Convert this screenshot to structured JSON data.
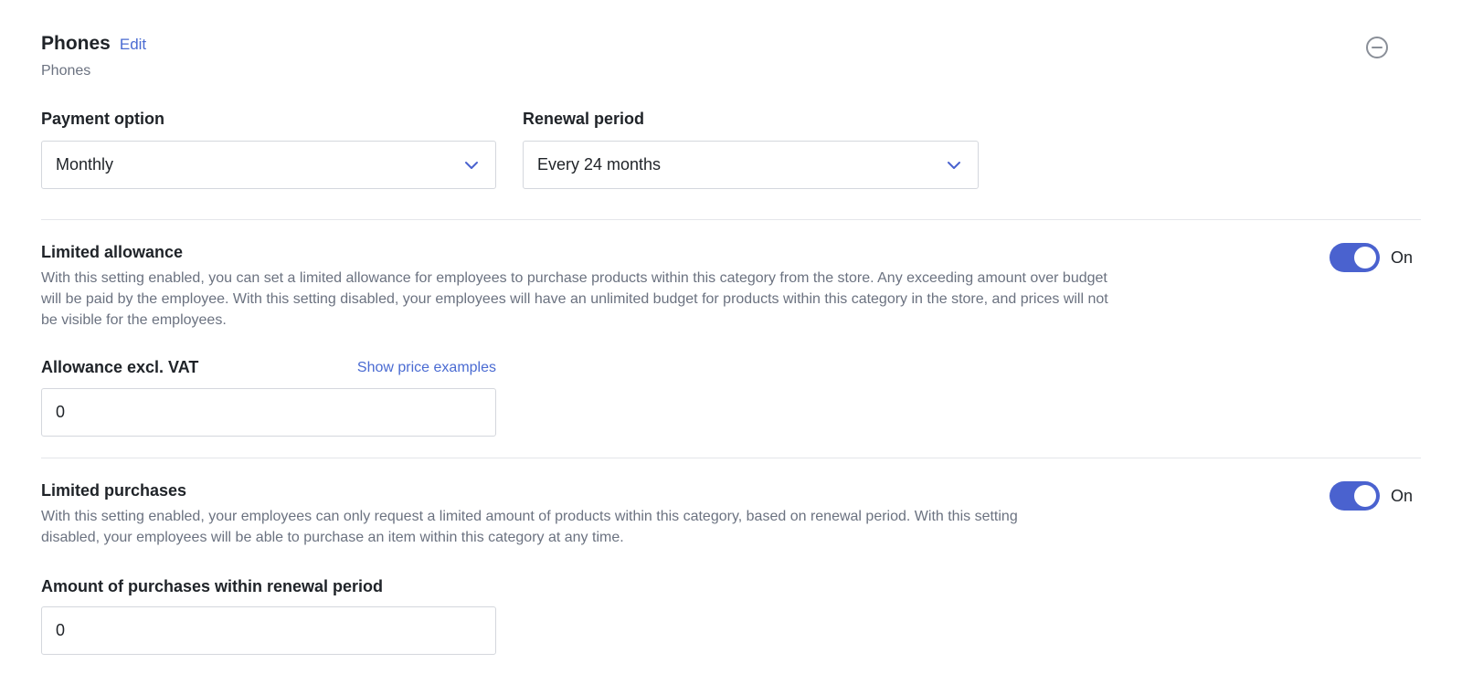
{
  "header": {
    "title": "Phones",
    "edit_label": "Edit",
    "subtitle": "Phones",
    "collapse_icon": "minus-circle-icon"
  },
  "payment_option": {
    "label": "Payment option",
    "selected": "Monthly"
  },
  "renewal_period": {
    "label": "Renewal period",
    "selected": "Every 24 months"
  },
  "limited_allowance": {
    "title": "Limited allowance",
    "description_lines": [
      "With this setting enabled, you can set a limited allowance for employees to purchase products within this category from the store. Any exceeding amount over budget",
      "will be paid by the employee. With this setting disabled, your employees will have an unlimited budget for products within this category in the store, and prices will not",
      "be visible for the employees."
    ],
    "toggle_state": "On",
    "allowance_label": "Allowance excl. VAT",
    "price_examples_link": "Show price examples",
    "allowance_value": "0"
  },
  "limited_purchases": {
    "title": "Limited purchases",
    "description_lines": [
      "With this setting enabled, your employees can only request a limited amount of products within this category, based on renewal period. With this setting",
      "disabled, your employees will be able to purchase an item within this category at any time."
    ],
    "toggle_state": "On",
    "amount_label": "Amount of purchases within renewal period",
    "amount_value": "0"
  },
  "colors": {
    "accent": "#4a62cf",
    "link": "#4a6bd2",
    "muted_text": "#6b7280",
    "border": "#d4d7dd"
  }
}
